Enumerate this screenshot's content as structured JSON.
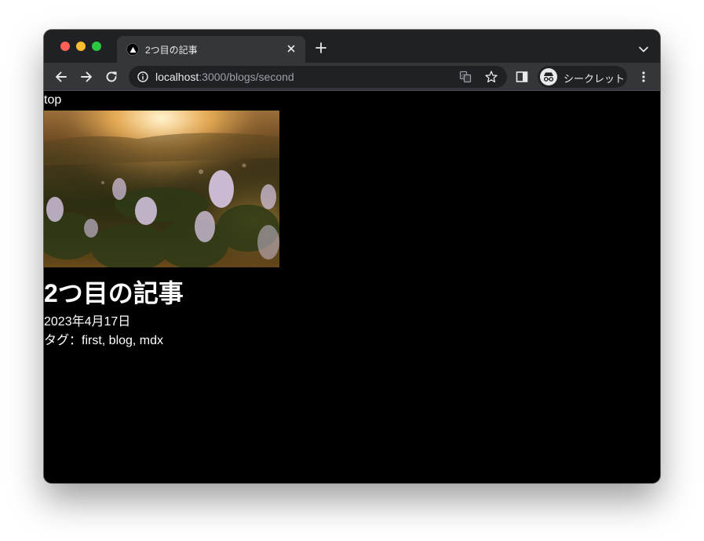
{
  "browser": {
    "tab_title": "2つ目の記事",
    "url_host": "localhost",
    "url_rest": ":3000/blogs/second",
    "profile_label": "シークレット",
    "colors": {
      "tabstrip": "#202124",
      "toolbar": "#35363a",
      "omnibox": "#202124"
    }
  },
  "page": {
    "top_link": "top",
    "hero_image": "sunset-flowers-photo",
    "title": "2つ目の記事",
    "date": "2023年4月17日",
    "tags": "タグ：first, blog, mdx",
    "background": "#000000",
    "text_color": "#ffffff"
  }
}
